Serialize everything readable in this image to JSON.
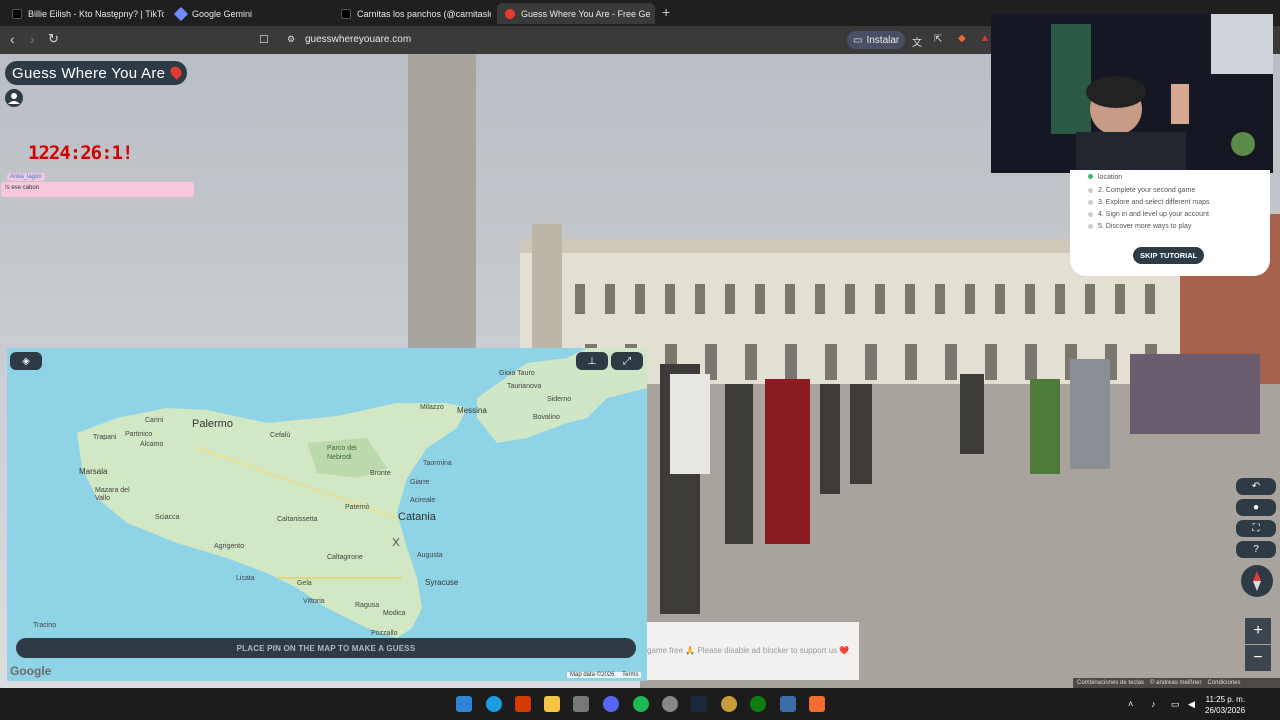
{
  "browser": {
    "tabs": [
      {
        "title": "Billie Eilish - Kto Następny? | TikTok",
        "icon": "tiktok-icon",
        "color": "#000000"
      },
      {
        "title": "Google Gemini",
        "icon": "gemini-icon",
        "color": "#6f8cff"
      },
      {
        "title": "Carnitas los panchos (@carnitaslospa",
        "icon": "tiktok-icon",
        "color": "#000000"
      },
      {
        "title": "Guess Where You Are - Free Ge",
        "icon": "pin-icon",
        "color": "#e53935",
        "active": true
      }
    ],
    "url": "guesswhereyouare.com",
    "install_label": "Instalar"
  },
  "game": {
    "title": "Guess Where You Are",
    "timer": "1224:26:1!",
    "map_button_place_pin": "PLACE PIN ON THE MAP TO MAKE A GUESS",
    "map_data": "Map data ©2026",
    "map_terms": "Terms",
    "google_logo": "Google"
  },
  "chat": {
    "user": "Anka_lagon",
    "message": "!s ese cabon"
  },
  "tutorial": {
    "steps": [
      "location",
      "2. Complete your second game",
      "3. Explore and select different maps",
      "4. Sign in and level up your account",
      "5. Discover more ways to play"
    ],
    "skip_label": "SKIP TUTORIAL"
  },
  "ad": {
    "text": "game free 🙏 Please disable ad blocker to support us ❤️"
  },
  "streetview_footer": {
    "shortcuts": "Combinaciones de teclas",
    "copyright": "© andreas meißner",
    "conditions": "Condiciones"
  },
  "map": {
    "cities": [
      {
        "name": "Palermo",
        "size": "big"
      },
      {
        "name": "Messina",
        "size": "med"
      },
      {
        "name": "Catania",
        "size": "big"
      },
      {
        "name": "Syracuse",
        "size": "med"
      },
      {
        "name": "Marsala",
        "size": "med"
      },
      {
        "name": "Trapani",
        "size": "sm"
      },
      {
        "name": "Agrigento",
        "size": "sm"
      },
      {
        "name": "Caltanissetta",
        "size": "sm"
      },
      {
        "name": "Caltagirone",
        "size": "sm"
      },
      {
        "name": "Gela",
        "size": "sm"
      },
      {
        "name": "Ragusa",
        "size": "sm"
      },
      {
        "name": "Vittoria",
        "size": "sm"
      },
      {
        "name": "Modica",
        "size": "sm"
      },
      {
        "name": "Augusta",
        "size": "sm"
      },
      {
        "name": "Acireale",
        "size": "sm"
      },
      {
        "name": "Giarre",
        "size": "sm"
      },
      {
        "name": "Taormina",
        "size": "sm"
      },
      {
        "name": "Bronte",
        "size": "sm"
      },
      {
        "name": "Paternò",
        "size": "sm"
      },
      {
        "name": "Milazzo",
        "size": "sm"
      },
      {
        "name": "Cefalù",
        "size": "sm"
      },
      {
        "name": "Sciacca",
        "size": "sm"
      },
      {
        "name": "Licata",
        "size": "sm"
      },
      {
        "name": "Alcamo",
        "size": "sm"
      },
      {
        "name": "Carini",
        "size": "sm"
      },
      {
        "name": "Partinico",
        "size": "sm"
      },
      {
        "name": "Mazara del Vallo",
        "size": "sm"
      },
      {
        "name": "Parco dei Nebrodi",
        "size": "sm"
      },
      {
        "name": "Gioia Tauro",
        "size": "sm"
      },
      {
        "name": "Taurianova",
        "size": "sm"
      },
      {
        "name": "Siderno",
        "size": "sm"
      },
      {
        "name": "Bovalino",
        "size": "sm"
      },
      {
        "name": "Pozzallo",
        "size": "sm"
      },
      {
        "name": "Tracino",
        "size": "sm"
      }
    ]
  },
  "taskbar": {
    "time": "11:25 p. m.",
    "date": "26/03/2026"
  }
}
